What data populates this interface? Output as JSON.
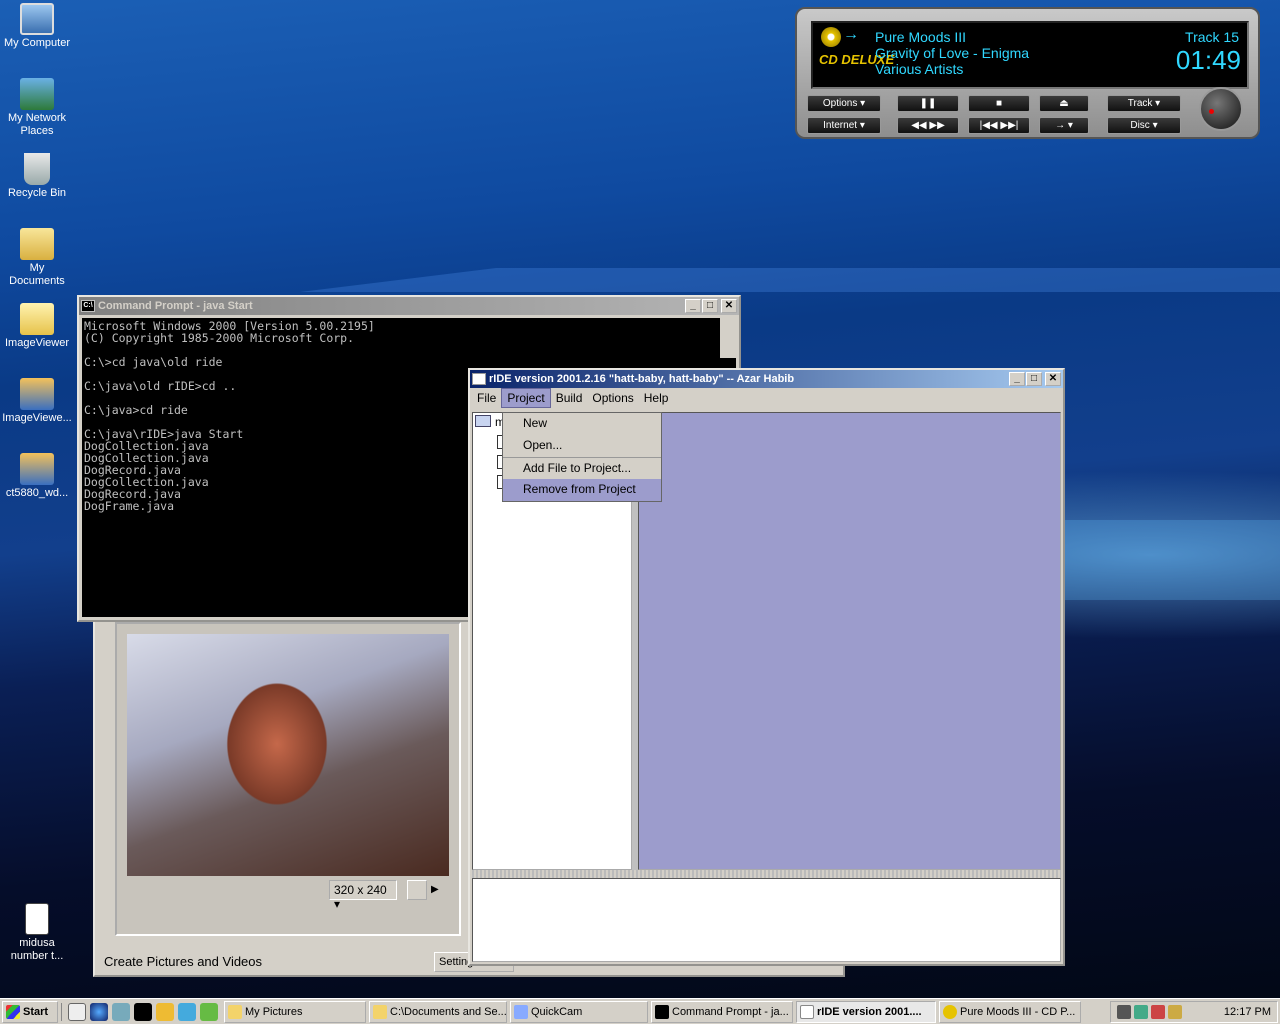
{
  "desktop": {
    "icons": [
      {
        "label": "My Computer",
        "icon": "computer-icon"
      },
      {
        "label": "My Network Places",
        "icon": "network-icon"
      },
      {
        "label": "Recycle Bin",
        "icon": "recycle-bin-icon"
      },
      {
        "label": "My Documents",
        "icon": "folder-documents-icon"
      },
      {
        "label": "ImageViewer",
        "icon": "folder-icon"
      },
      {
        "label": "ImageViewe...",
        "icon": "app-icon"
      },
      {
        "label": "ct5880_wd...",
        "icon": "app-icon"
      },
      {
        "label": "midusa number t...",
        "icon": "document-icon"
      }
    ]
  },
  "cdplayer": {
    "album": "Pure Moods III",
    "track_title": "Gravity of Love - Enigma",
    "artist": "Various Artists",
    "track": "Track 15",
    "time": "01:49",
    "logo": "CD DELUXE",
    "buttons": {
      "options": "Options",
      "internet": "Internet",
      "track": "Track",
      "disc": "Disc"
    }
  },
  "cmd": {
    "title": "Command Prompt - java Start",
    "lines": "Microsoft Windows 2000 [Version 5.00.2195]\n(C) Copyright 1985-2000 Microsoft Corp.\n\nC:\\>cd java\\old ride\n\nC:\\java\\old rIDE>cd ..\n\nC:\\java>cd ride\n\nC:\\java\\rIDE>java Start\nDogCollection.java\nDogCollection.java\nDogRecord.java\nDogCollection.java\nDogRecord.java\nDogFrame.java"
  },
  "quickcam": {
    "resolution": "320 x 240",
    "footer": "Create Pictures and Videos",
    "settings": "Settings"
  },
  "ride": {
    "title": "rIDE version 2001.2.16 \"hatt-baby, hatt-baby\" -- Azar Habib",
    "menus": [
      "File",
      "Project",
      "Build",
      "Options",
      "Help"
    ],
    "project_menu": [
      "New",
      "Open...",
      "Add File to Project...",
      "Remove from Project"
    ],
    "tree_root": "m",
    "colors": {
      "editor": "#9c9ccc"
    }
  },
  "taskbar": {
    "start": "Start",
    "tasks": [
      "My Pictures",
      "C:\\Documents and Se...",
      "QuickCam",
      "Command Prompt - ja...",
      "rIDE version 2001....",
      "Pure Moods III - CD P..."
    ],
    "clock": "12:17 PM"
  }
}
